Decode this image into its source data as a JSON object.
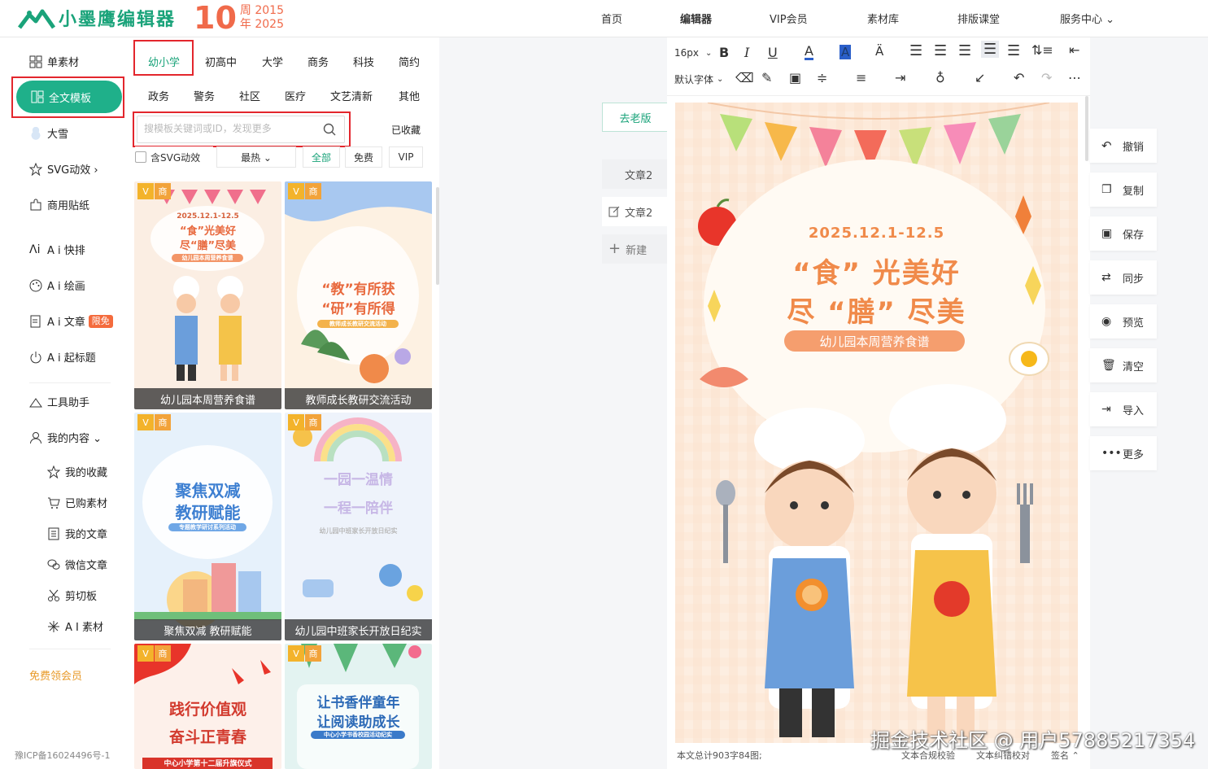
{
  "brand": {
    "name": "小墨鹰编辑器",
    "anniv_number": "10",
    "anniv_line1": "周 2015",
    "anniv_line2": "年 2025",
    "accent": "#1aa37a"
  },
  "nav": {
    "items": [
      "首页",
      "编辑器",
      "VIP会员",
      "素材库",
      "排版课堂",
      "服务中心 ⌄"
    ],
    "active": "编辑器"
  },
  "sidebar": {
    "items": [
      "单素材",
      "全文模板",
      "大雪",
      "SVG动效  ›",
      "商用贴纸",
      "A i 快排",
      "A i 绘画",
      "A i 文章",
      "A i 起标题",
      "工具助手",
      "我的内容 ⌄",
      "我的收藏",
      "已购素材",
      "我的文章",
      "微信文章",
      "剪切板",
      "A I 素材"
    ],
    "badge": "限免",
    "member": "免费领会员",
    "icp": "豫ICP备16024496号-1"
  },
  "templates": {
    "categories_row1": [
      "幼小学",
      "初高中",
      "大学",
      "商务",
      "科技",
      "简约"
    ],
    "categories_row2": [
      "政务",
      "警务",
      "社区",
      "医疗",
      "文艺清新",
      "其他"
    ],
    "search_placeholder": "搜模板关键词或ID，发现更多",
    "collected": "已收藏",
    "filters": [
      "含SVG动效",
      "最热  ⌄",
      "全部",
      "免费",
      "VIP"
    ],
    "tag_v": "V",
    "tag_shang": "商",
    "cards": [
      {
        "title": "幼儿园本周营养食谱",
        "l1": "2025.12.1-12.5",
        "l2": "“食”光美好",
        "l3": "尽“膳”尽美",
        "l4": "幼儿园本周营养食谱"
      },
      {
        "title": "教师成长教研交流活动",
        "l1": "“教”有所获",
        "l2": "“研”有所得",
        "l3": "教师成长教研交流活动"
      },
      {
        "title": "聚焦双减 教研赋能",
        "l1": "聚焦双减",
        "l2": "教研赋能",
        "l3": "专题教学研讨系列活动"
      },
      {
        "title": "幼儿园中班家长开放日纪实",
        "l1": "一园一温情",
        "l2": "一程一陪伴",
        "l3": "幼儿园中班家长开放日纪实"
      },
      {
        "title": "",
        "l1": "践行价值观",
        "l2": "奋斗正青春",
        "l3": "中心小学第十二届升旗仪式"
      },
      {
        "title": "",
        "l1": "让书香伴童年",
        "l2": "让阅读助成长",
        "l3": "中心小学书香校园活动纪实"
      }
    ]
  },
  "articles": {
    "old_version": "去老版",
    "list": [
      "文章2",
      "文章2"
    ],
    "new": "新建"
  },
  "toolbar": {
    "font_size": "16px",
    "font_family": "默认字体"
  },
  "poster": {
    "date": "2025.12.1-12.5",
    "line1": "“食” 光美好",
    "line2": "尽 “膳” 尽美",
    "subtitle": "幼儿园本周营养食谱"
  },
  "status": {
    "count": "本文总计903字84图;",
    "check1": "文本合规校验",
    "check2": "文本纠错校对",
    "sign": "签名 ⌃"
  },
  "actions": [
    "撤销",
    "复制",
    "保存",
    "同步",
    "预览",
    "清空",
    "导入",
    "更多"
  ],
  "watermark": "掘金技术社区 @ 用户57885217354"
}
